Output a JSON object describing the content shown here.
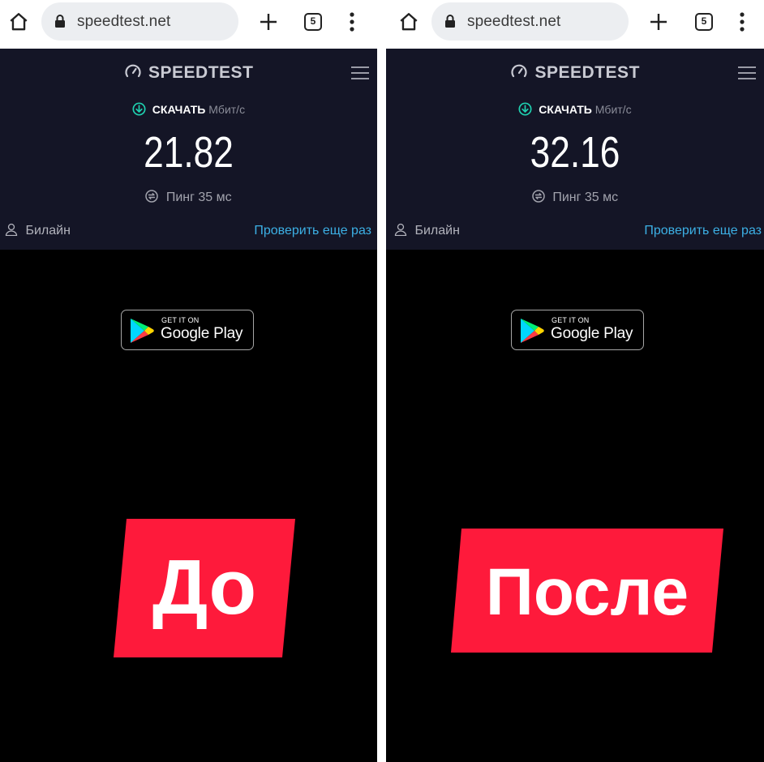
{
  "colors": {
    "header_bg": "#141526",
    "accent_link": "#3cb0e5",
    "download_icon": "#1fd1b0",
    "tag_red": "#fe1a3b"
  },
  "panels": [
    {
      "browser": {
        "url": "speedtest.net",
        "tab_count": "5",
        "icons": [
          "home-icon",
          "lock-icon",
          "plus-icon",
          "tabs-icon",
          "more-vert-icon"
        ]
      },
      "speedtest": {
        "logo": "SPEEDTEST",
        "download_label": "СКАЧАТЬ",
        "download_unit": "Мбит/с",
        "speed": "21.82",
        "ping": "Пинг 35 мс",
        "isp": "Билайн",
        "retest": "Проверить еще раз"
      },
      "store_badge": {
        "small": "GET IT ON",
        "big": "Google Play"
      },
      "tag": "До"
    },
    {
      "browser": {
        "url": "speedtest.net",
        "tab_count": "5",
        "icons": [
          "home-icon",
          "lock-icon",
          "plus-icon",
          "tabs-icon",
          "more-vert-icon"
        ]
      },
      "speedtest": {
        "logo": "SPEEDTEST",
        "download_label": "СКАЧАТЬ",
        "download_unit": "Мбит/с",
        "speed": "32.16",
        "ping": "Пинг 35 мс",
        "isp": "Билайн",
        "retest": "Проверить еще раз"
      },
      "store_badge": {
        "small": "GET IT ON",
        "big": "Google Play"
      },
      "tag": "После"
    }
  ]
}
